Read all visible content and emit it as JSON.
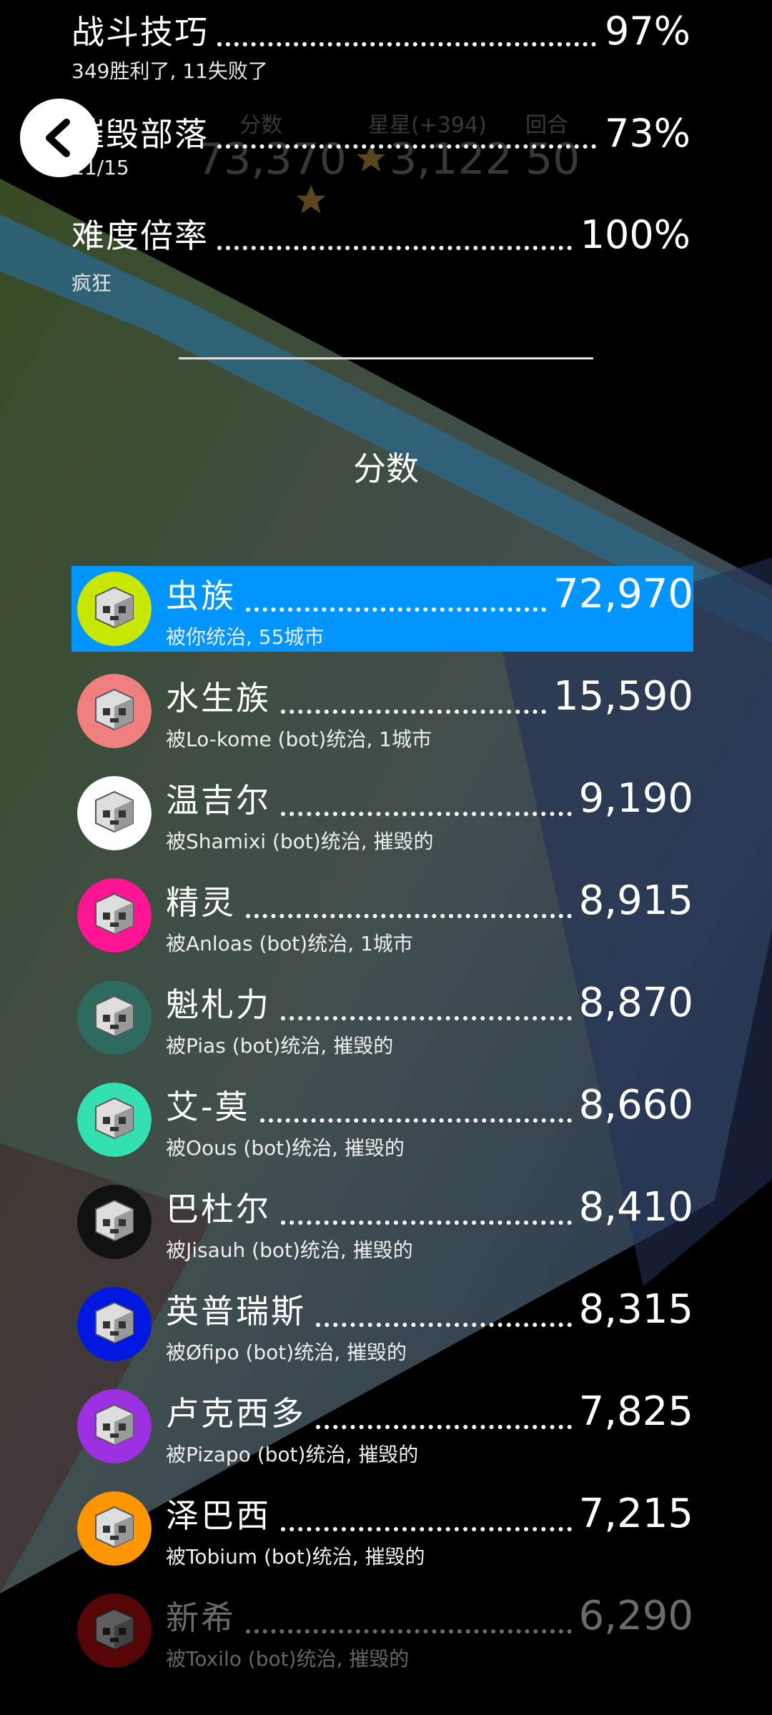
{
  "stats": [
    {
      "name": "战斗技巧",
      "value": "97%",
      "sub": "349胜利了, 11失败了"
    },
    {
      "name": "摧毁部落",
      "value": "73%",
      "sub": "11/15"
    },
    {
      "name": "难度倍率",
      "value": "100%",
      "sub": "疯狂"
    }
  ],
  "hud_ghost": {
    "score_label": "分数",
    "score_value": "73,370",
    "stars_label": "星星(+394)",
    "stars_value": "3,122",
    "turns_label": "回合",
    "turns_value": "50"
  },
  "score_title": "分数",
  "rows": [
    {
      "name": "虫族",
      "score": "72,970",
      "ruler": "被你统治, 55城市",
      "avatar_color": "#c8e800",
      "highlight": true
    },
    {
      "name": "水生族",
      "score": "15,590",
      "ruler": "被Lo-kome (bot)统治, 1城市",
      "avatar_color": "#f08080"
    },
    {
      "name": "温吉尔",
      "score": "9,190",
      "ruler": "被Shamixi (bot)统治, 摧毁的",
      "avatar_color": "#ffffff"
    },
    {
      "name": "精灵",
      "score": "8,915",
      "ruler": "被Anloas (bot)统治, 1城市",
      "avatar_color": "#ff1493"
    },
    {
      "name": "魁札力",
      "score": "8,870",
      "ruler": "被Pias (bot)统治, 摧毁的",
      "avatar_color": "#2e6b5e"
    },
    {
      "name": "艾-莫",
      "score": "8,660",
      "ruler": "被Oous (bot)统治, 摧毁的",
      "avatar_color": "#33e0b0"
    },
    {
      "name": "巴杜尔",
      "score": "8,410",
      "ruler": "被Jisauh (bot)统治, 摧毁的",
      "avatar_color": "#111111"
    },
    {
      "name": "英普瑞斯",
      "score": "8,315",
      "ruler": "被Øfipo (bot)统治, 摧毁的",
      "avatar_color": "#0018e0"
    },
    {
      "name": "卢克西多",
      "score": "7,825",
      "ruler": "被Pizapo (bot)统治, 摧毁的",
      "avatar_color": "#9b30e0"
    },
    {
      "name": "泽巴西",
      "score": "7,215",
      "ruler": "被Tobium (bot)统治, 摧毁的",
      "avatar_color": "#ff9500"
    },
    {
      "name": "新希",
      "score": "6,290",
      "ruler": "被Toxilo (bot)统治, 摧毁的",
      "avatar_color": "#cc1010",
      "faded": true
    }
  ]
}
